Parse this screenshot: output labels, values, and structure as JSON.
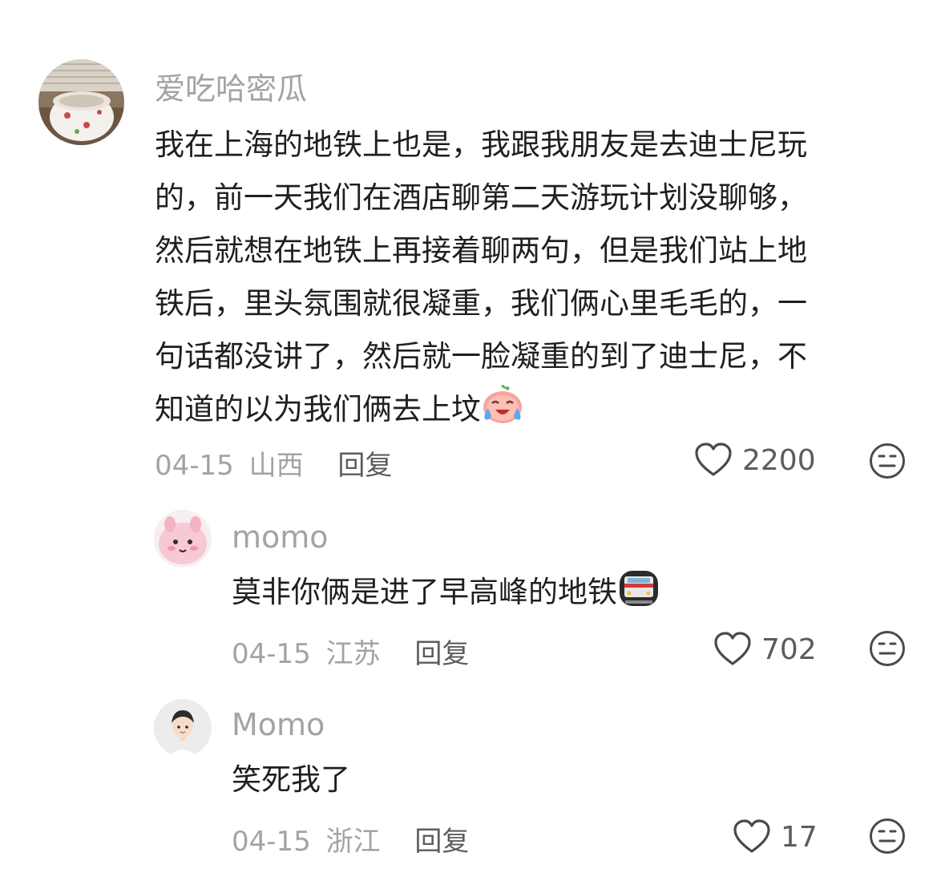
{
  "comments": [
    {
      "username": "爱吃哈密瓜",
      "avatar_icon": "bowl-avatar",
      "lines": [
        "我在上海的地铁上也是，我跟我朋友是去迪士尼玩",
        "的，前一天我们在酒店聊第二天游玩计划没聊够，",
        "然后就想在地铁上再接着聊两句，但是我们站上地",
        "铁后，里头氛围就很凝重，我们俩心里毛毛的，一",
        "句话都没讲了，然后就一脸凝重的到了迪士尼，不",
        "知道的以为我们俩去上坟"
      ],
      "trailing_emoji": "crying-laughing-peach-emoji",
      "date": "04-15",
      "location": "山西",
      "reply_label": "回复",
      "likes": "2200"
    },
    {
      "username": "momo",
      "avatar_icon": "pink-plush-avatar",
      "text": "莫非你俩是进了早高峰的地铁",
      "trailing_emoji": "subway-emoji",
      "date": "04-15",
      "location": "江苏",
      "reply_label": "回复",
      "likes": "702"
    },
    {
      "username": "Momo",
      "avatar_icon": "boy-avatar",
      "text": "笑死我了",
      "date": "04-15",
      "location": "浙江",
      "reply_label": "回复",
      "likes": "17"
    }
  ],
  "colors": {
    "text": "#1f1f1f",
    "muted": "#a3a3a3",
    "action": "#5c5c5c"
  }
}
